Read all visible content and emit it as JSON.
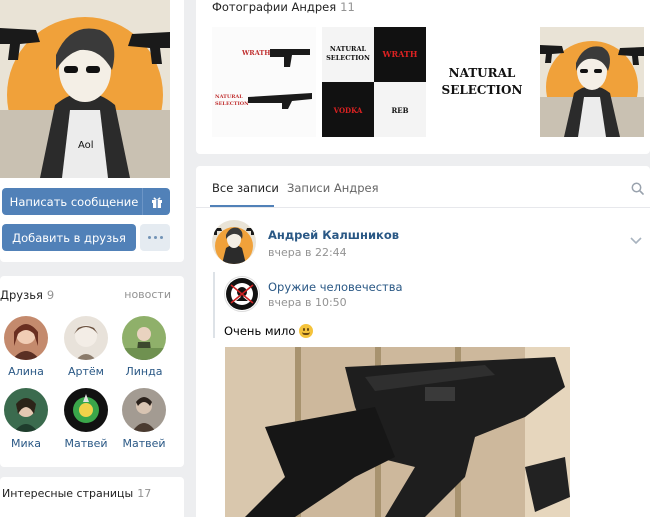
{
  "profile": {
    "send_message_label": "Написать сообщение",
    "add_friend_label": "Добавить в друзья"
  },
  "friends": {
    "title": "Друзья",
    "count": "9",
    "news_link": "новости",
    "items": [
      {
        "name": "Алина"
      },
      {
        "name": "Артём"
      },
      {
        "name": "Линда"
      },
      {
        "name": "Мика"
      },
      {
        "name": "Матвей"
      },
      {
        "name": "Матвей"
      }
    ]
  },
  "interesting": {
    "title": "Интересные страницы",
    "count": "17"
  },
  "photos": {
    "title": "Фотографии Андрея",
    "count": "11",
    "thumb_texts": {
      "wrath_small": "WRATH",
      "natural_small": "NATURAL SELECTION",
      "collage_natural": "NATURAL SELECTION",
      "collage_wrath": "WRATH",
      "collage_vodka": "VODKA",
      "collage_reb": "REB",
      "natural_big_line1": "NATURAL",
      "natural_big_line2": "SELECTION"
    }
  },
  "wall": {
    "tabs": [
      {
        "label": "Все записи"
      },
      {
        "label": "Записи Андрея"
      }
    ],
    "post": {
      "author": "Андрей Калшников",
      "time": "вчера в 22:44",
      "repost": {
        "author": "Оружие человечества",
        "time": "вчера в 10:50"
      },
      "text": "Очень мило"
    }
  },
  "colors": {
    "accent": "#5181b8",
    "link": "#2a5885",
    "muted": "#939393",
    "background": "#edeef0",
    "avatar_orange": "#f0a13a"
  },
  "icons": [
    "gift-icon",
    "more-icon",
    "search-icon",
    "chevron-down-icon",
    "smile-emoji-icon"
  ]
}
